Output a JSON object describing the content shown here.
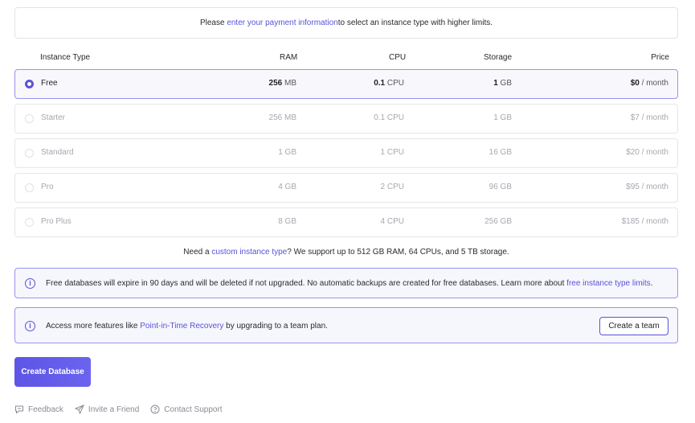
{
  "top_banner": {
    "prefix": "Please ",
    "link": "enter your payment information",
    "suffix": " to select an instance type with higher limits."
  },
  "table": {
    "headers": {
      "type": "Instance Type",
      "ram": "RAM",
      "cpu": "CPU",
      "storage": "Storage",
      "price": "Price"
    },
    "rows": [
      {
        "name": "Free",
        "ram_num": "256",
        "ram_unit": " MB",
        "cpu_num": "0.1",
        "cpu_unit": " CPU",
        "storage_num": "1",
        "storage_unit": " GB",
        "price_num": "$0",
        "price_unit": " / month",
        "selected": true
      },
      {
        "name": "Starter",
        "ram_num": "256",
        "ram_unit": " MB",
        "cpu_num": "0.1",
        "cpu_unit": " CPU",
        "storage_num": "1",
        "storage_unit": " GB",
        "price_num": "$7",
        "price_unit": " / month",
        "selected": false
      },
      {
        "name": "Standard",
        "ram_num": "1",
        "ram_unit": " GB",
        "cpu_num": "1",
        "cpu_unit": " CPU",
        "storage_num": "16",
        "storage_unit": " GB",
        "price_num": "$20",
        "price_unit": " / month",
        "selected": false
      },
      {
        "name": "Pro",
        "ram_num": "4",
        "ram_unit": " GB",
        "cpu_num": "2",
        "cpu_unit": " CPU",
        "storage_num": "96",
        "storage_unit": " GB",
        "price_num": "$95",
        "price_unit": " / month",
        "selected": false
      },
      {
        "name": "Pro Plus",
        "ram_num": "8",
        "ram_unit": " GB",
        "cpu_num": "4",
        "cpu_unit": " CPU",
        "storage_num": "256",
        "storage_unit": " GB",
        "price_num": "$185",
        "price_unit": " / month",
        "selected": false
      }
    ]
  },
  "custom_note": {
    "prefix": "Need a ",
    "link": "custom instance type",
    "suffix": "? We support up to 512 GB RAM, 64 CPUs, and 5 TB storage."
  },
  "free_info": {
    "text": "Free databases will expire in 90 days and will be deleted if not upgraded. No automatic backups are created for free databases. Learn more about ",
    "link": "free instance type limits",
    "suffix": "."
  },
  "team_info": {
    "prefix": "Access more features like ",
    "link": "Point-in-Time Recovery",
    "suffix": " by upgrading to a team plan.",
    "button": "Create a team"
  },
  "create_button": "Create Database",
  "footer": {
    "feedback": "Feedback",
    "invite": "Invite a Friend",
    "support": "Contact Support"
  },
  "colors": {
    "accent": "#5a52d8",
    "selected_border": "#9a93ee"
  }
}
